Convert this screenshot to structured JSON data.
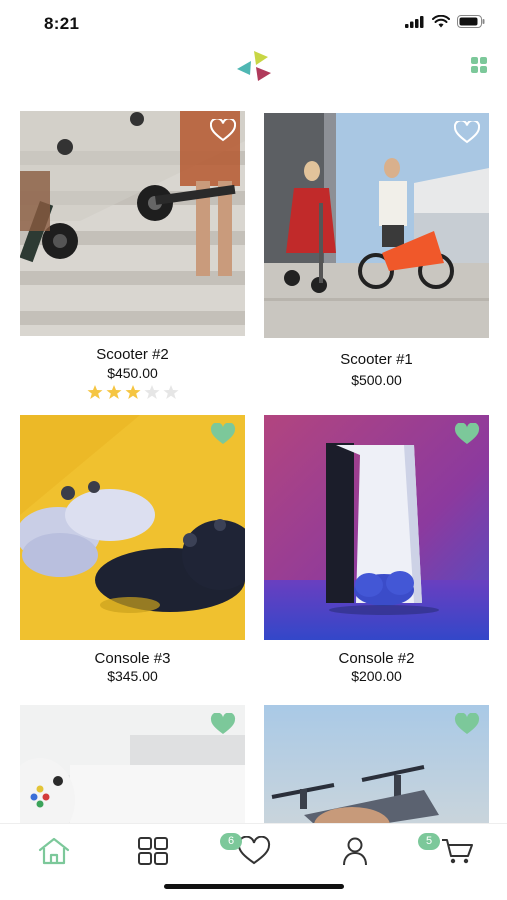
{
  "status_bar": {
    "time": "8:21"
  },
  "colors": {
    "accent": "#7cc89a",
    "star_filled": "#f5c542",
    "star_empty": "#e6e6e6"
  },
  "products": [
    {
      "name": "Scooter #2",
      "price": "$450.00",
      "rating": 3,
      "rating_max": 5,
      "favorited": false,
      "image": "scooter-stairs-photo"
    },
    {
      "name": "Scooter #1",
      "price": "$500.00",
      "favorited": false,
      "image": "scooter-couple-photo"
    },
    {
      "name": "Console #3",
      "price": "$345.00",
      "favorited": true,
      "image": "controllers-yellow-photo"
    },
    {
      "name": "Console #2",
      "price": "$200.00",
      "favorited": true,
      "image": "ps5-purple-photo"
    },
    {
      "favorited": true,
      "image": "xbox-console-photo"
    },
    {
      "favorited": true,
      "image": "drone-sky-photo"
    }
  ],
  "bottom_nav": {
    "items": [
      {
        "icon": "home-icon",
        "active": true
      },
      {
        "icon": "categories-icon",
        "active": false
      },
      {
        "icon": "heart-icon",
        "active": false,
        "badge": "6"
      },
      {
        "icon": "profile-icon",
        "active": false
      },
      {
        "icon": "cart-icon",
        "active": false,
        "badge": "5"
      }
    ]
  }
}
